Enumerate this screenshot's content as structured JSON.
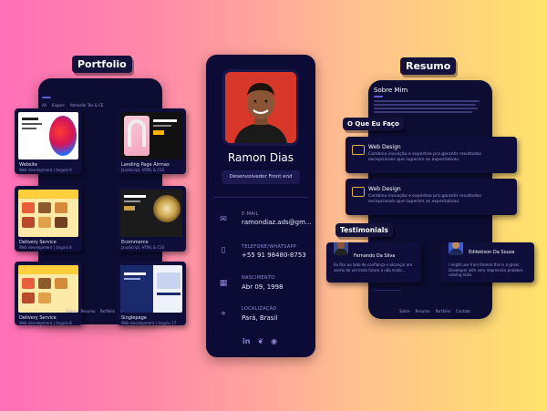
{
  "portfolio": {
    "heading": "Portfolio",
    "tabs": [
      "All",
      "Engine",
      "Atmosfer Tes & CE"
    ],
    "items": [
      {
        "title": "Website",
        "sub": "Web development | ângulo 9"
      },
      {
        "title": "Landing Page Airmax",
        "sub": "JavaScript, HTML & CSS"
      },
      {
        "title": "Delivery Service",
        "sub": "Web development | ângulo 8"
      },
      {
        "title": "Ecommerce",
        "sub": "JavaScript, HTML & CSS"
      },
      {
        "title": "Delivery Service",
        "sub": "Web development | ângulo 8"
      },
      {
        "title": "Singlepage",
        "sub": "Web development | ângulo 17"
      }
    ],
    "footer": [
      "Sobre",
      "Resumo",
      "Portfolio"
    ]
  },
  "profile": {
    "name": "Ramon Dias",
    "role": "Desenvolvedor Front end",
    "contacts": [
      {
        "icon": "mail-icon",
        "label": "E-MAIL",
        "value": "ramondiaz.ads@gm..."
      },
      {
        "icon": "phone-icon",
        "label": "TELEFONE/WHATSAPP",
        "value": "+55 91 98480-8753"
      },
      {
        "icon": "calendar-icon",
        "label": "NASCIMENTO",
        "value": "Abr 09, 1998"
      },
      {
        "icon": "location-icon",
        "label": "LOCALIZAÇÃO",
        "value": "Pará, Brasil"
      }
    ]
  },
  "resumo": {
    "heading": "Resumo",
    "about_title": "Sobre Mim",
    "services_title": "O Que Eu Faço",
    "services": [
      {
        "title": "Web Design",
        "text": "Combino inovação e expertise pra garantir resultados excepcionais que superam as expectativas."
      },
      {
        "title": "Web Design",
        "text": "Combino inovação e expertise pra garantir resultados excepcionais que superam as expectativas."
      }
    ],
    "testimonials_title": "Testimonials",
    "testimonials": [
      {
        "name": "Fernando Da Silva",
        "text": "Eu fico ao lado de confiança e alcançar um sonho de um lindo futuro a não ecolo..."
      },
      {
        "name": "Edilekison Da Souza",
        "text": "I might use from Ramon this is a great. Developer with very impressive problem-solving skills."
      }
    ],
    "footer": [
      "Sobre",
      "Resumo",
      "Portfolio",
      "Contato"
    ]
  }
}
